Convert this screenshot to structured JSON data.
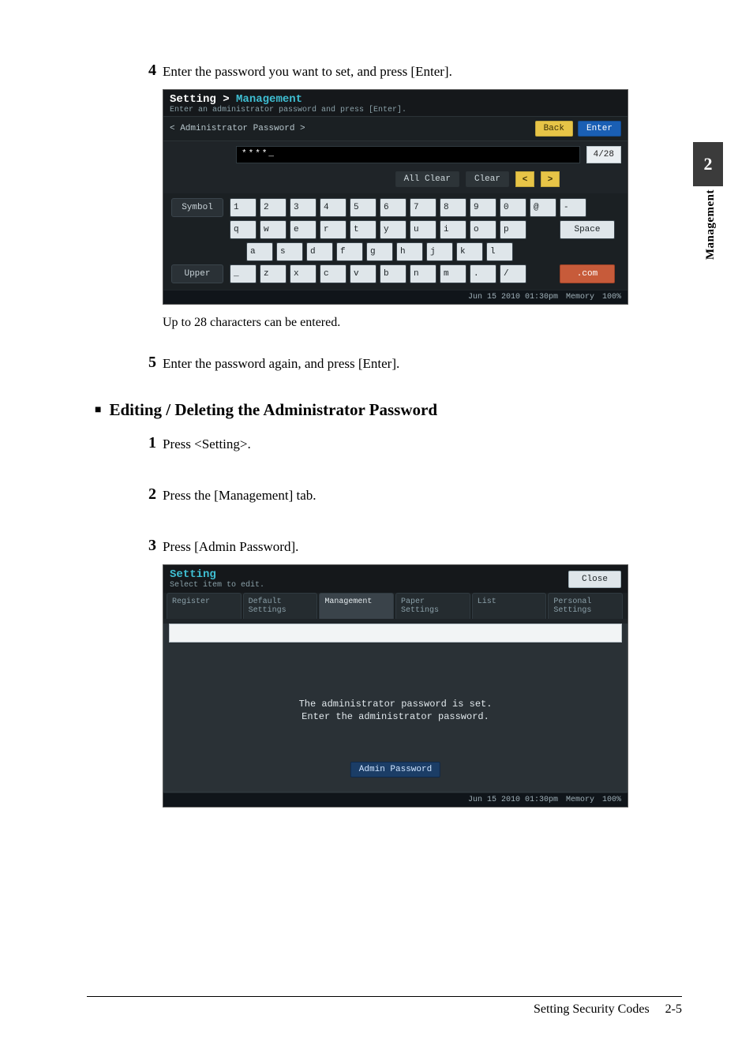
{
  "side": {
    "chapter": "2",
    "label": "Management"
  },
  "steps_a": {
    "s4": {
      "num": "4",
      "text": "Enter the password you want to set, and press [Enter]."
    },
    "note": "Up to 28 characters can be entered.",
    "s5": {
      "num": "5",
      "text": "Enter the password again, and press [Enter]."
    }
  },
  "section_b_title": "Editing / Deleting the Administrator Password",
  "steps_b": {
    "s1": {
      "num": "1",
      "text": "Press <Setting>."
    },
    "s2": {
      "num": "2",
      "text": "Press the [Management] tab."
    },
    "s3": {
      "num": "3",
      "text": "Press [Admin Password]."
    }
  },
  "shot1": {
    "breadcrumb_a": "Setting",
    "breadcrumb_sep": ">",
    "breadcrumb_b": "Management",
    "hint": "Enter an administrator password and press [Enter].",
    "pw_label": "< Administrator Password >",
    "back": "Back",
    "enter": "Enter",
    "input_value": "****_",
    "counter": "4/28",
    "all_clear": "All Clear",
    "clear": "Clear",
    "arrow_l": "<",
    "arrow_r": ">",
    "symbol": "Symbol",
    "upper": "Upper",
    "space": "Space",
    "dotcom": ".com",
    "rows": {
      "r1": [
        "1",
        "2",
        "3",
        "4",
        "5",
        "6",
        "7",
        "8",
        "9",
        "0",
        "@",
        "-"
      ],
      "r2": [
        "q",
        "w",
        "e",
        "r",
        "t",
        "y",
        "u",
        "i",
        "o",
        "p"
      ],
      "r3": [
        "a",
        "s",
        "d",
        "f",
        "g",
        "h",
        "j",
        "k",
        "l"
      ],
      "r4": [
        "_",
        "z",
        "x",
        "c",
        "v",
        "b",
        "n",
        "m",
        ".",
        "/"
      ]
    },
    "footer_time": "Jun 15 2010 01:30pm",
    "footer_mem": "Memory",
    "footer_pct": "100%"
  },
  "shot2": {
    "title": "Setting",
    "hint": "Select item to edit.",
    "close": "Close",
    "tabs": [
      "Register",
      "Default\nSettings",
      "Management",
      "Paper\nSettings",
      "List",
      "Personal\nSettings"
    ],
    "active_tab_index": 2,
    "msg_l1": "The administrator password is set.",
    "msg_l2": "Enter the administrator password.",
    "admin_btn": "Admin Password",
    "footer_time": "Jun 15 2010 01:30pm",
    "footer_mem": "Memory",
    "footer_pct": "100%"
  },
  "footer": {
    "left": "Setting Security Codes",
    "right": "2-5"
  }
}
